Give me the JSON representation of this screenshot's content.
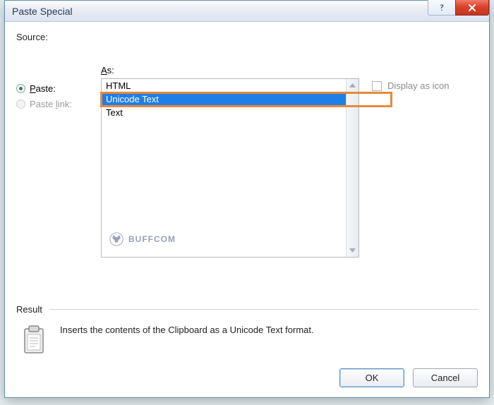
{
  "dialog": {
    "title": "Paste Special",
    "source_label": "Source:",
    "as_label": "As:",
    "result_label": "Result",
    "result_text": "Inserts the contents of the Clipboard as a Unicode Text format."
  },
  "radios": {
    "paste_label": "Paste:",
    "paste_mn": "P",
    "paste_selected": true,
    "pastelink_label": "Paste link:",
    "pastelink_mn": "l",
    "pastelink_enabled": false
  },
  "listbox": {
    "options": [
      {
        "label": "HTML"
      },
      {
        "label": "Unicode Text"
      },
      {
        "label": "Text"
      }
    ],
    "selected_index": 1
  },
  "display_as_icon": {
    "label": "Display as icon",
    "checked": false,
    "enabled": false
  },
  "buttons": {
    "ok": "OK",
    "cancel": "Cancel"
  },
  "watermark": {
    "text": "BUFFCOM"
  }
}
